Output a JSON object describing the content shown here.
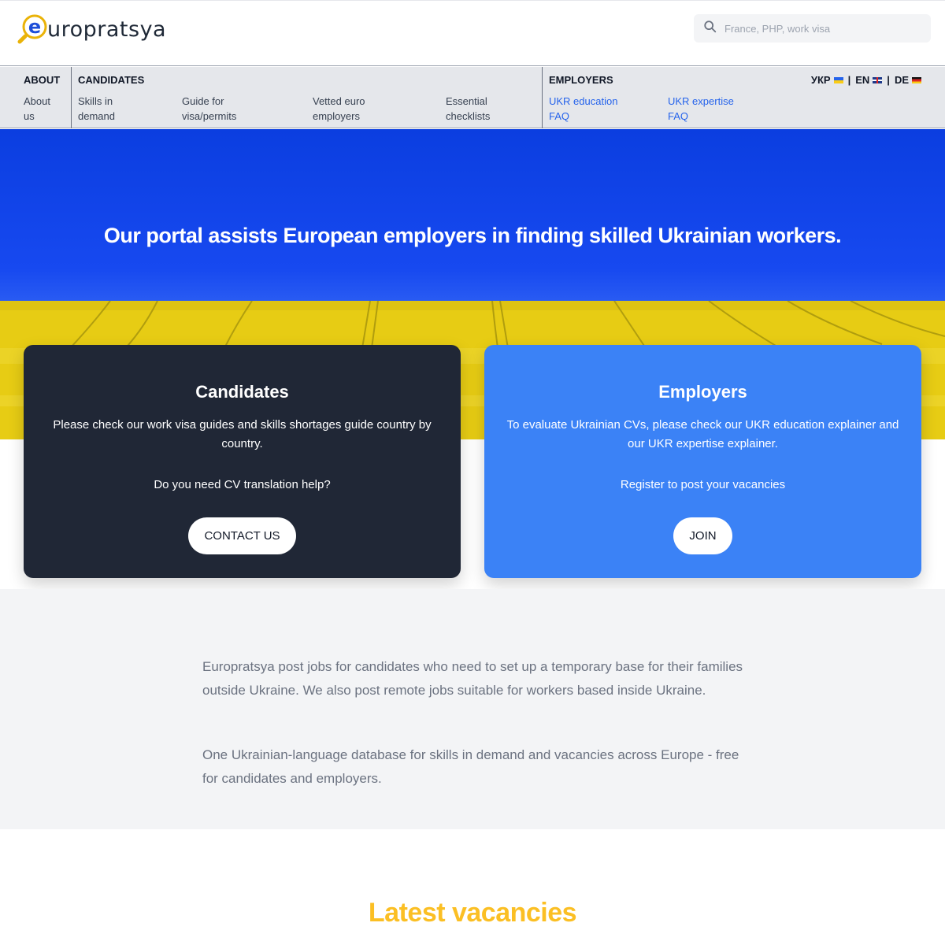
{
  "header": {
    "logo_text": "uropratsya",
    "search_placeholder": "France, PHP, work visa"
  },
  "nav": {
    "about": {
      "heading": "ABOUT",
      "links": [
        "About us"
      ]
    },
    "candidates": {
      "heading": "CANDIDATES",
      "links": [
        "Skills in demand",
        "Guide for visa/permits",
        "Vetted euro employers",
        "Essential checklists"
      ]
    },
    "employers": {
      "heading": "EMPLOYERS",
      "links": [
        "UKR education FAQ",
        "UKR expertise FAQ"
      ]
    },
    "languages": [
      "УКР",
      "EN",
      "DE"
    ]
  },
  "hero": {
    "title": "Our portal assists European employers in finding skilled Ukrainian workers."
  },
  "cards": {
    "candidates": {
      "title": "Candidates",
      "text": "Please check our work visa guides and skills shortages guide country by country.",
      "question": "Do you need CV translation help?",
      "button": "CONTACT US"
    },
    "employers": {
      "title": "Employers",
      "text": "To evaluate Ukrainian CVs, please check our UKR education explainer and our UKR expertise explainer.",
      "question": "Register to post your vacancies",
      "button": "JOIN"
    }
  },
  "info": {
    "paragraph1": "Europratsya post jobs for candidates who need to set up a temporary base for their families outside Ukraine. We also post remote jobs suitable for workers based inside Ukraine.",
    "paragraph2": "One Ukrainian-language database for skills in demand and vacancies across Europe - free for candidates and employers."
  },
  "latest": {
    "title": "Latest vacancies"
  },
  "colors": {
    "accent_blue": "#3b82f6",
    "dark_card": "#202736",
    "hero_blue": "#0b3ee0",
    "field_yellow": "#e9cf15",
    "latest_yellow": "#fbbf24"
  }
}
